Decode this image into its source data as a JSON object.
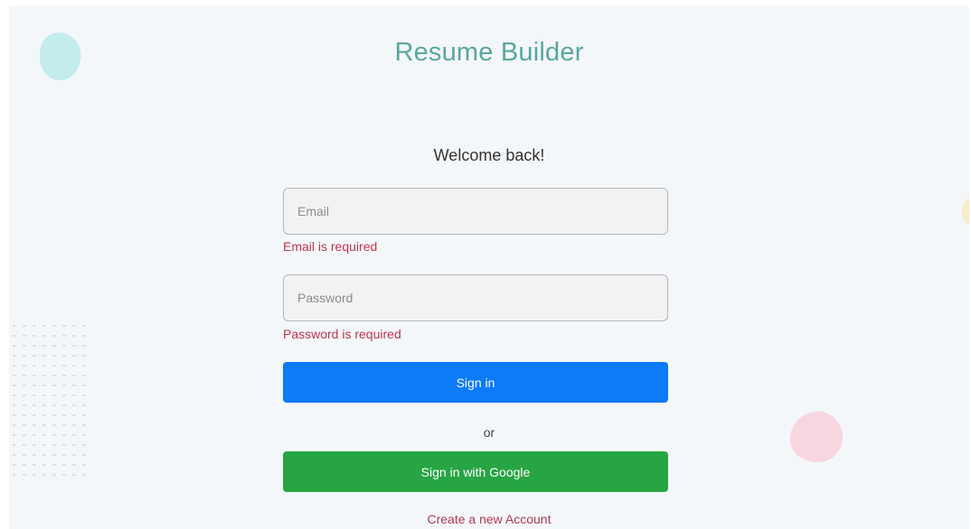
{
  "app": {
    "title": "Resume Builder"
  },
  "login": {
    "welcome": "Welcome back!",
    "email": {
      "placeholder": "Email",
      "value": "",
      "error": "Email is required"
    },
    "password": {
      "placeholder": "Password",
      "value": "",
      "error": "Password is required"
    },
    "sign_in_label": "Sign in",
    "or_label": "or",
    "google_label": "Sign in with Google",
    "create_account_label": "Create a new Account"
  },
  "colors": {
    "title": "#5aa7a0",
    "primary": "#0d7af8",
    "google": "#27a544",
    "error": "#c0344e",
    "link": "#b03a55",
    "background": "#f4f7fa"
  },
  "decorations": [
    "teal-blob",
    "pink-blob",
    "yellow-blob",
    "dot-grid"
  ]
}
